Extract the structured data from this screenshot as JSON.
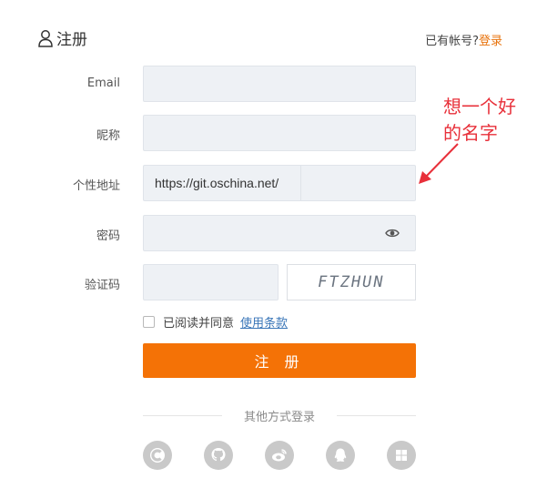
{
  "header": {
    "title": "注册",
    "login_prompt": "已有帐号?",
    "login_link": "登录"
  },
  "form": {
    "email_label": "Email",
    "nickname_label": "昵称",
    "profile_label": "个性地址",
    "profile_prefix": "https://git.oschina.net/",
    "password_label": "密码",
    "captcha_label": "验证码",
    "captcha_text": "FTZHUN",
    "agree_text": "已阅读并同意",
    "terms_link": "使用条款",
    "submit_label": "注 册"
  },
  "social": {
    "divider_text": "其他方式登录",
    "icons": [
      "oschina-icon",
      "github-icon",
      "weibo-icon",
      "qq-icon",
      "windows-icon"
    ]
  },
  "annotation": {
    "line1": "想一个好",
    "line2": "的名字",
    "color": "#e8303a"
  },
  "colors": {
    "accent": "#f47206",
    "link": "#3a76b8"
  }
}
